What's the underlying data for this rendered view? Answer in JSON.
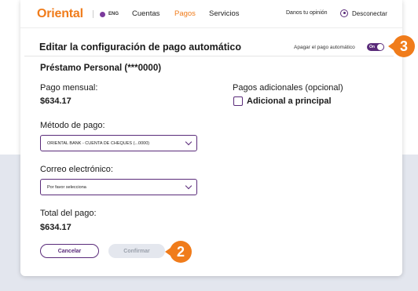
{
  "nav": {
    "logo": "Oriental",
    "lang": "ENG",
    "items": [
      "Cuentas",
      "Pagos",
      "Servicios"
    ],
    "active": "Pagos",
    "opinion": "Danos tu opinión",
    "logout": "Desconectar"
  },
  "card": {
    "title": "Editar la configuración de pago automático",
    "autopay_label": "Apagar el pago automático",
    "toggle_text": "On",
    "toggle_state": "on",
    "loan_name": "Préstamo Personal (***0000)",
    "monthly_label": "Pago mensual:",
    "monthly_value": "$634.17",
    "additional_label": "Pagos adicionales (opcional)",
    "additional_checkbox": "Adicional a principal",
    "payment_method_label": "Método de pago:",
    "payment_method_value": "ORIENTAL BANK - CUENTA DE CHEQUES (...0000)",
    "email_label": "Correo electrónico:",
    "email_value": "Por favor selecciona",
    "total_label": "Total del pago:",
    "total_value": "$634.17",
    "cancel": "Cancelar",
    "confirm": "Confirmar"
  },
  "callouts": {
    "step_2": "2",
    "step_3": "3"
  },
  "colors": {
    "accent": "#f07c1b",
    "primary": "#5a2b7a"
  }
}
